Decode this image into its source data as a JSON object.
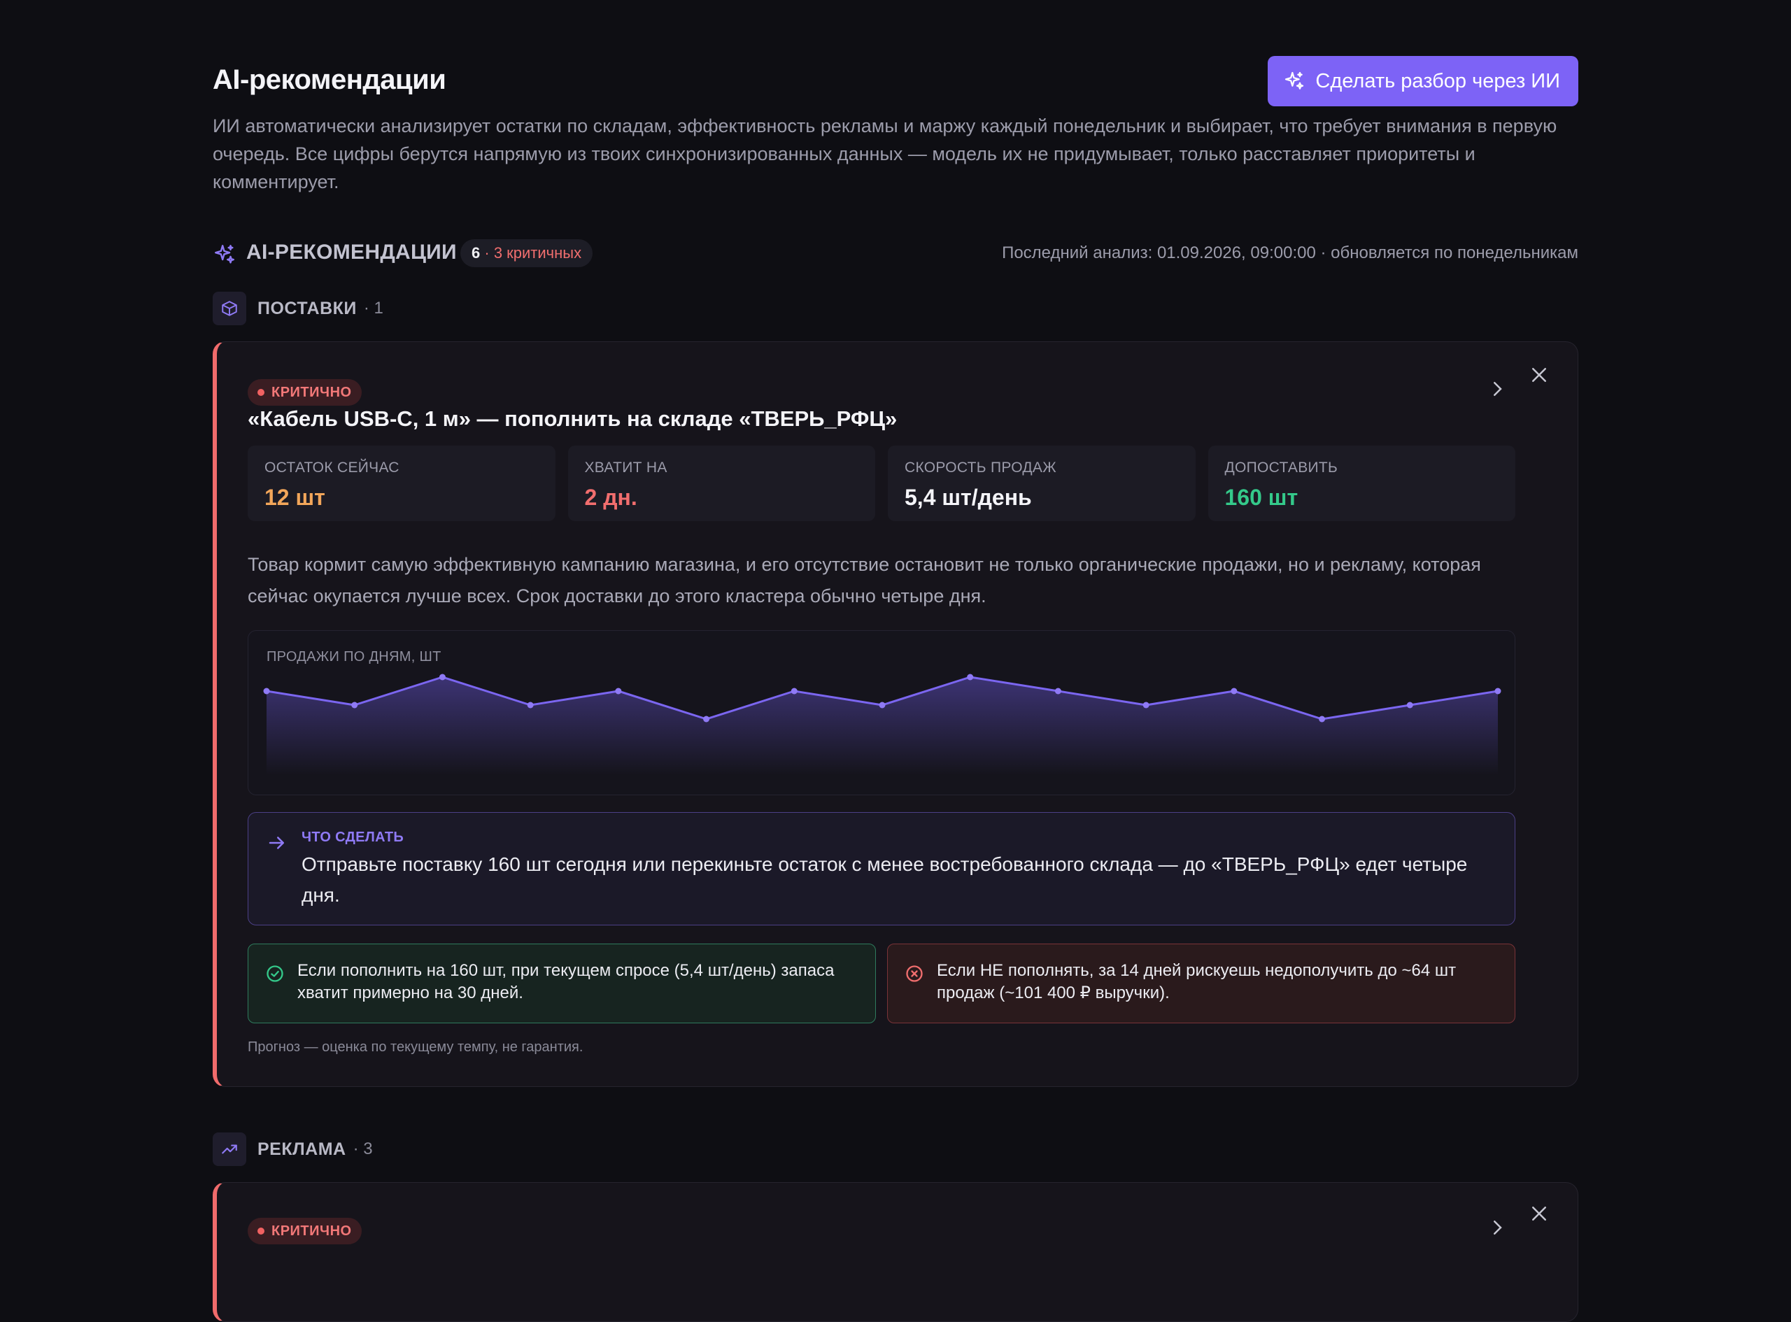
{
  "header": {
    "title": "AI-рекомендации",
    "description": "ИИ автоматически анализирует остатки по складам, эффективность рекламы и маржу каждый понедельник и выбирает, что требует внимания в первую очередь. Все цифры берутся напрямую из твоих синхронизированных данных — модель их не придумывает, только расставляет приоритеты и комментирует.",
    "action_label": "Сделать разбор через ИИ"
  },
  "summary": {
    "title": "AI-РЕКОМЕНДАЦИИ",
    "count": "6",
    "critical": "· 3 критичных",
    "meta": "Последний анализ: 01.09.2026, 09:00:00 · обновляется по понедельникам"
  },
  "sections": [
    {
      "label": "ПОСТАВКИ",
      "count": "· 1",
      "card": {
        "severity": "КРИТИЧНО",
        "title": "«Кабель USB-C, 1 м» — пополнить на складе «ТВЕРЬ_РФЦ»",
        "metrics": [
          {
            "label": "ОСТАТОК СЕЙЧАС",
            "value": "12 шт",
            "color": "#f2a65a"
          },
          {
            "label": "ХВАТИТ НА",
            "value": "2 дн.",
            "color": "#f26e6e"
          },
          {
            "label": "СКОРОСТЬ ПРОДАЖ",
            "value": "5,4 шт/день",
            "color": "#f4f4f8"
          },
          {
            "label": "ДОПОСТАВИТЬ",
            "value": "160 шт",
            "color": "#34c98a"
          }
        ],
        "explanation": "Товар кормит самую эффективную кампанию магазина, и его отсутствие остановит не только органические продажи, но и рекламу, которая сейчас окупается лучше всех. Срок доставки до этого кластера обычно четыре дня.",
        "todo_label": "ЧТО СДЕЛАТЬ",
        "todo_text": "Отправьте поставку 160 шт сегодня или перекиньте остаток с менее востребованного склада — до «ТВЕРЬ_РФЦ» едет четыре дня.",
        "outcome_good": "Если пополнить на 160 шт, при текущем спросе (5,4 шт/день) запаса хватит примерно на 30 дней.",
        "outcome_bad": "Если НЕ пополнять, за 14 дней рискуешь недополучить до ~64 шт продаж (~101 400 ₽ выручки).",
        "note": "Прогноз — оценка по текущему темпу, не гарантия."
      }
    },
    {
      "label": "РЕКЛАМА",
      "count": "· 3",
      "card": {
        "severity": "КРИТИЧНО"
      }
    }
  ],
  "chart_data": {
    "type": "area",
    "title": "ПРОДАЖИ ПО ДНЯМ, ШТ",
    "x": [
      1,
      2,
      3,
      4,
      5,
      6,
      7,
      8,
      9,
      10,
      11,
      12,
      13,
      14,
      15
    ],
    "values": [
      6,
      5,
      7,
      5,
      6,
      4,
      6,
      5,
      7,
      6,
      5,
      6,
      4,
      5,
      6
    ],
    "ylim": [
      0,
      7
    ],
    "grid": false,
    "color": "#7b66f0"
  },
  "colors": {
    "accent": "#7d63f6",
    "critical": "#f06b6b",
    "success": "#34c98a"
  }
}
